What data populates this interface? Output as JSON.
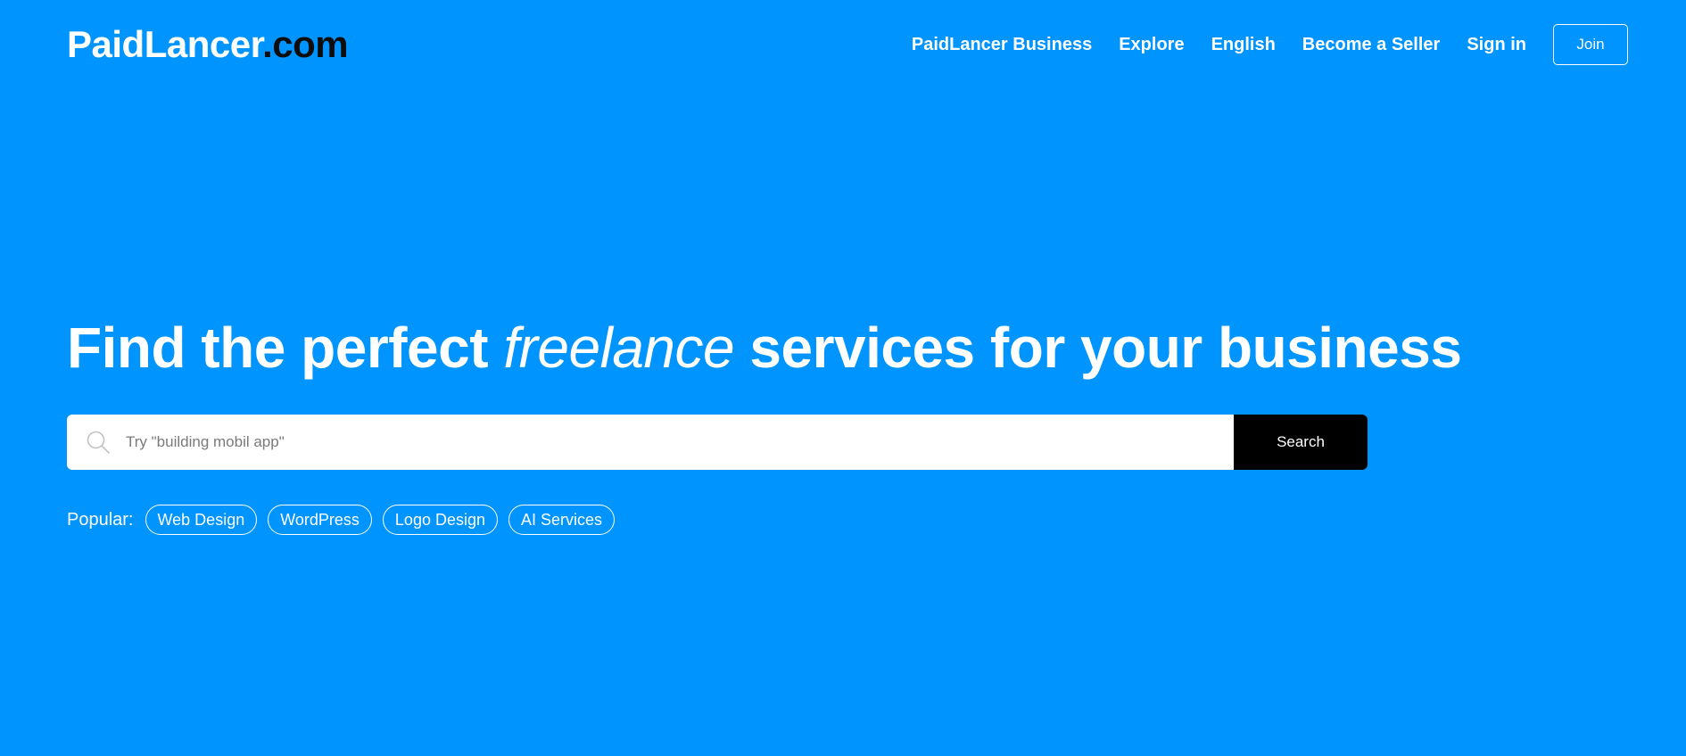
{
  "brand": {
    "name": "PaidLancer",
    "tld": ".com"
  },
  "nav": {
    "items": [
      {
        "label": "PaidLancer Business"
      },
      {
        "label": "Explore"
      },
      {
        "label": "English"
      },
      {
        "label": "Become a Seller"
      },
      {
        "label": "Sign in"
      }
    ],
    "join_label": "Join"
  },
  "hero": {
    "title_before": "Find the perfect ",
    "title_emphasis": "freelance",
    "title_after": " services for your business"
  },
  "search": {
    "placeholder": "Try \"building mobil app\"",
    "value": "",
    "button_label": "Search",
    "icon": "search-icon"
  },
  "popular": {
    "label": "Popular:",
    "tags": [
      {
        "label": "Web Design"
      },
      {
        "label": "WordPress"
      },
      {
        "label": "Logo Design"
      },
      {
        "label": "AI Services"
      }
    ]
  },
  "colors": {
    "background": "#0094ff",
    "text": "#ffffff",
    "search_button": "#000000",
    "logo_tld": "#0d0d0d"
  }
}
